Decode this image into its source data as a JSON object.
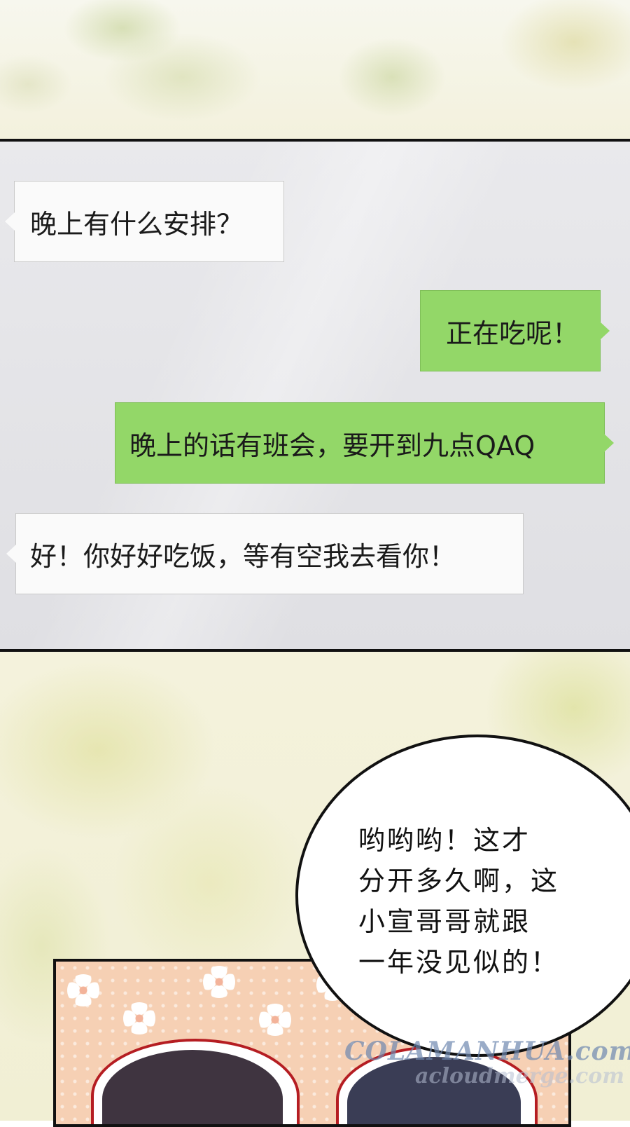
{
  "chat": {
    "messages": [
      {
        "side": "left",
        "text": "晚上有什么安排？"
      },
      {
        "side": "right",
        "text": "正在吃呢！"
      },
      {
        "side": "right",
        "text": "晚上的话有班会，要开到九点QAQ"
      },
      {
        "side": "left",
        "text": "好！你好好吃饭，等有空我去看你！"
      }
    ]
  },
  "speech_bubble": {
    "text": "哟哟哟！这才\n分开多久啊，这\n小宣哥哥就跟\n一年没见似的！"
  },
  "watermark": {
    "line1": "COLAMANHUA.com",
    "line2": "acloudmerge.com"
  },
  "colors": {
    "incoming_bubble": "#fafafa",
    "outgoing_bubble": "#93d768",
    "panel_border": "#111111"
  }
}
